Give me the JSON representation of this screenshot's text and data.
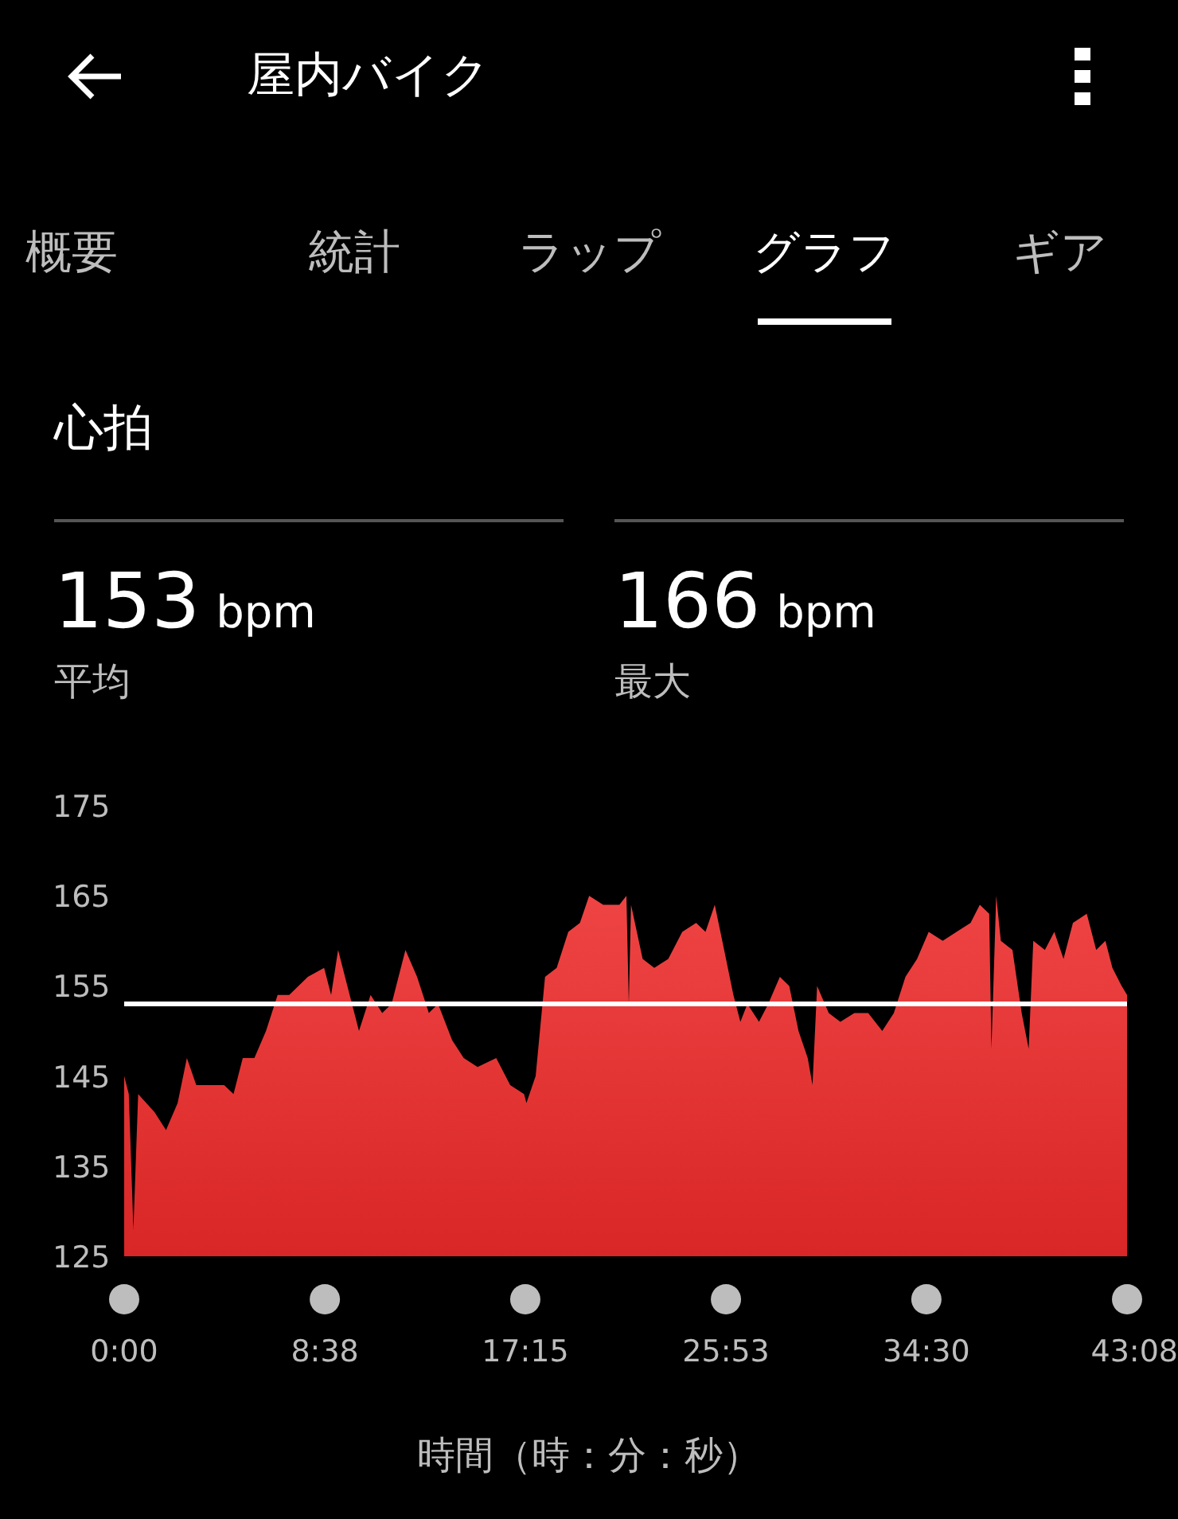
{
  "header": {
    "title": "屋内バイク"
  },
  "tabs": [
    {
      "label": "概要",
      "selected": false
    },
    {
      "label": "統計",
      "selected": false
    },
    {
      "label": "ラップ",
      "selected": false
    },
    {
      "label": "グラフ",
      "selected": true
    },
    {
      "label": "ギア",
      "selected": false
    }
  ],
  "section": {
    "title": "心拍"
  },
  "stats": [
    {
      "value": "153",
      "unit": "bpm",
      "label": "平均"
    },
    {
      "value": "166",
      "unit": "bpm",
      "label": "最大"
    }
  ],
  "chart": {
    "chart_data": {
      "type": "area",
      "xlabel": "時間（時：分：秒）",
      "ylim": [
        125,
        175
      ],
      "xlim": [
        0,
        43.13
      ],
      "yticks": [
        125,
        135,
        145,
        155,
        165,
        175
      ],
      "xticks": [
        {
          "value": 0,
          "label": "0:00"
        },
        {
          "value": 8.63,
          "label": "8:38"
        },
        {
          "value": 17.25,
          "label": "17:15"
        },
        {
          "value": 25.88,
          "label": "25:53"
        },
        {
          "value": 34.5,
          "label": "34:30"
        },
        {
          "value": 43.13,
          "label": "43:08"
        }
      ],
      "x": [
        0,
        0.2,
        0.4,
        0.6,
        1.3,
        1.8,
        2.3,
        2.7,
        3.1,
        3.6,
        4.3,
        4.7,
        5.1,
        5.6,
        6.1,
        6.6,
        7.1,
        7.9,
        8.6,
        8.9,
        9.2,
        9.6,
        10.1,
        10.6,
        11.1,
        11.5,
        12.1,
        12.6,
        13.1,
        13.5,
        14.1,
        14.6,
        15.2,
        16,
        16.6,
        17.2,
        17.3,
        17.7,
        18.1,
        18.6,
        19.1,
        19.6,
        20,
        20.6,
        21.3,
        21.6,
        21.7,
        21.8,
        22.3,
        22.8,
        23.4,
        24,
        24.6,
        25,
        25.4,
        25.8,
        26.2,
        26.5,
        26.8,
        27.3,
        27.7,
        28.2,
        28.6,
        29,
        29.4,
        29.6,
        29.8,
        30.3,
        30.8,
        31.4,
        32,
        32.6,
        33.1,
        33.6,
        34.1,
        34.6,
        35.2,
        35.8,
        36.4,
        36.8,
        37.2,
        37.3,
        37.5,
        37.7,
        38.2,
        38.6,
        38.9,
        39.1,
        39.6,
        40,
        40.4,
        40.8,
        41.4,
        41.8,
        42.2,
        42.5,
        42.9,
        43.13
      ],
      "series": [
        {
          "color": "#ef4444",
          "values": [
            145,
            143,
            128,
            143,
            141,
            139,
            142,
            147,
            144,
            144,
            144,
            143,
            147,
            147,
            150,
            154,
            154,
            156,
            157,
            154,
            159,
            155,
            150,
            154,
            152,
            153,
            159,
            156,
            152,
            153,
            149,
            147,
            146,
            147,
            144,
            143,
            142,
            145,
            156,
            157,
            161,
            162,
            165,
            164,
            164,
            165,
            153,
            164,
            158,
            157,
            158,
            161,
            162,
            161,
            164,
            159,
            154,
            151,
            153,
            151,
            153,
            156,
            155,
            150,
            147,
            144,
            155,
            152,
            151,
            152,
            152,
            150,
            152,
            156,
            158,
            161,
            160,
            161,
            162,
            164,
            163,
            148,
            165,
            160,
            159,
            152,
            148,
            160,
            159,
            161,
            158,
            162,
            163,
            159,
            160,
            157,
            155,
            154
          ]
        }
      ],
      "ref_lines": [
        {
          "axis": "y",
          "value": 153
        }
      ]
    }
  }
}
